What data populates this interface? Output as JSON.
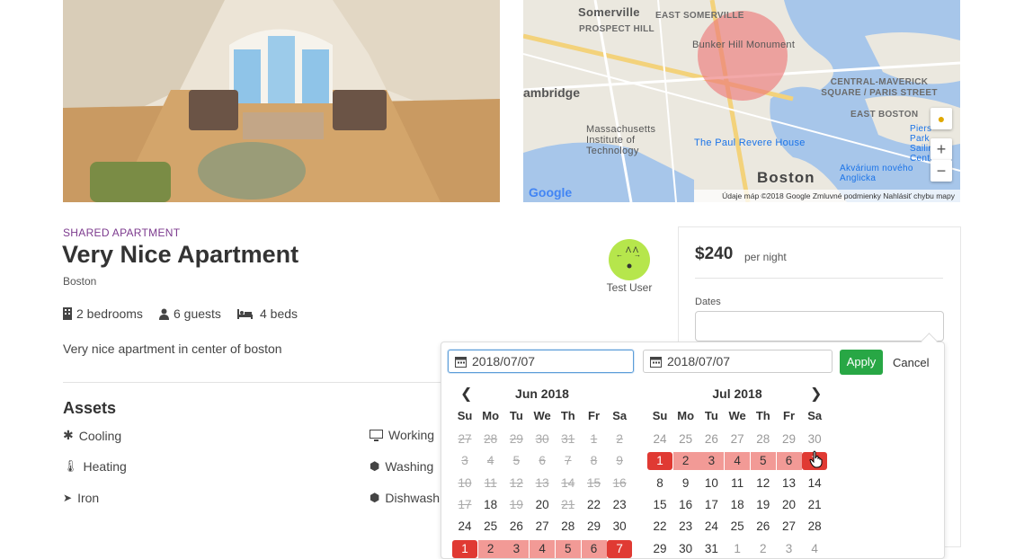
{
  "map": {
    "labels": [
      "Somerville",
      "EAST SOMERVILLE",
      "PROSPECT HILL",
      "Bunker Hill Monument",
      "ambridge",
      "CENTRAL-MAVERICK SQUARE / PARIS STREET",
      "EAST BOSTON",
      "Massachusetts Institute of Technology",
      "The Paul Revere House",
      "Boston",
      "Akvárium nového Anglicka",
      "Piers Park Sailing Center"
    ],
    "footer": "Údaje máp ©2018 Google   Zmluvné podmienky   Nahlásiť chybu mapy",
    "google": "Google",
    "zoom_in": "+",
    "zoom_out": "−"
  },
  "listing": {
    "type": "SHARED APARTMENT",
    "title": "Very Nice Apartment",
    "city": "Boston",
    "bedrooms": "2 bedrooms",
    "guests": "6 guests",
    "beds": "4 beds",
    "description": "Very nice apartment in center of boston",
    "assets_title": "Assets",
    "assets": [
      "Cooling",
      "Heating",
      "Iron",
      "Working",
      "Washing",
      "Dishwash"
    ]
  },
  "host": {
    "name": "Test User"
  },
  "booking": {
    "price": "$240",
    "per_night": "per night",
    "dates_label": "Dates"
  },
  "picker": {
    "start": "2018/07/07",
    "end": "2018/07/07",
    "apply": "Apply",
    "cancel": "Cancel",
    "weekdays": [
      "Su",
      "Mo",
      "Tu",
      "We",
      "Th",
      "Fr",
      "Sa"
    ],
    "months": [
      {
        "title": "Jun 2018",
        "weeks": [
          [
            "27",
            "28",
            "29",
            "30",
            "31",
            "1",
            "2"
          ],
          [
            "3",
            "4",
            "5",
            "6",
            "7",
            "8",
            "9"
          ],
          [
            "10",
            "11",
            "12",
            "13",
            "14",
            "15",
            "16"
          ],
          [
            "17",
            "18",
            "19",
            "20",
            "21",
            "22",
            "23"
          ],
          [
            "24",
            "25",
            "26",
            "27",
            "28",
            "29",
            "30"
          ],
          [
            "1",
            "2",
            "3",
            "4",
            "5",
            "6",
            "7"
          ]
        ]
      },
      {
        "title": "Jul 2018",
        "weeks": [
          [
            "24",
            "25",
            "26",
            "27",
            "28",
            "29",
            "30"
          ],
          [
            "1",
            "2",
            "3",
            "4",
            "5",
            "6",
            "7"
          ],
          [
            "8",
            "9",
            "10",
            "11",
            "12",
            "13",
            "14"
          ],
          [
            "15",
            "16",
            "17",
            "18",
            "19",
            "20",
            "21"
          ],
          [
            "22",
            "23",
            "24",
            "25",
            "26",
            "27",
            "28"
          ],
          [
            "29",
            "30",
            "31",
            "1",
            "2",
            "3",
            "4"
          ]
        ]
      }
    ]
  },
  "colors": {
    "accent_green": "#28a745",
    "selected_red": "#e03a33",
    "range_pink": "#f29a96",
    "type_purple": "#7c3a8e"
  }
}
